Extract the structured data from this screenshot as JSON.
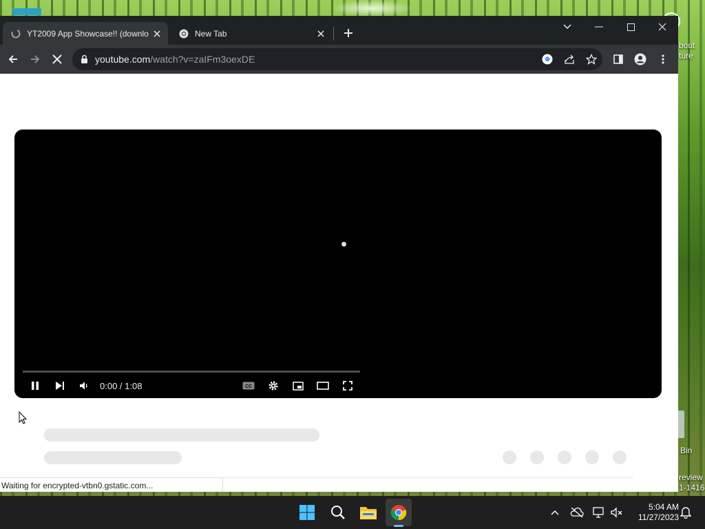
{
  "desktop": {
    "icon_text_1": "bout",
    "icon_text_2": "ture",
    "recycle_bin_label": "Bin",
    "watermark_line1": "review",
    "watermark_line2": "1-1416"
  },
  "browser": {
    "tabs": [
      {
        "title": "YT2009 App Showcase!! (downlo",
        "icon": "loading-globe-icon",
        "active": true
      },
      {
        "title": "New Tab",
        "icon": "chrome-icon",
        "active": false
      }
    ],
    "address": {
      "domain": "youtube.com",
      "path": "/watch?v=zaIFm3oexDE"
    },
    "status_text": "Waiting for encrypted-vtbn0.gstatic.com..."
  },
  "player": {
    "timecode": "0:00 / 1:08",
    "progress_fraction": 0.0
  },
  "taskbar": {
    "time": "5:04 AM",
    "date": "11/27/2023"
  },
  "colors": {
    "tabstrip": "#202124",
    "toolbar": "#35363a",
    "taskbar": "#1f1f1f",
    "accent": "#7cb7ff"
  }
}
